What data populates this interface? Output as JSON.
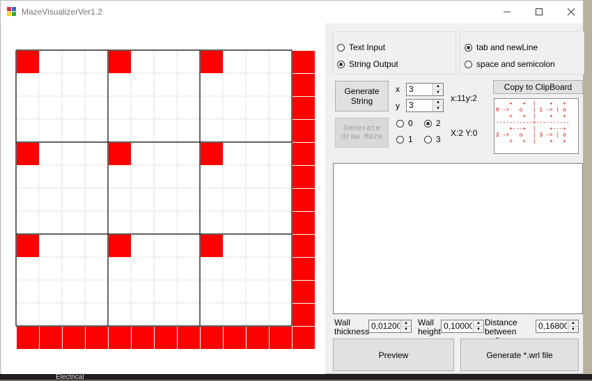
{
  "window": {
    "title": "MazeVisualizerVer1.2"
  },
  "mode": {
    "text_input": "Text Input",
    "string_output": "String Output",
    "selected": "string_output"
  },
  "format": {
    "tab_newline": "tab and newLine",
    "space_semicolon": "space and semicolon",
    "selected": "tab_newline"
  },
  "buttons": {
    "generate_string": "Generate String",
    "generate_draw_maze": "Generate draw Maze",
    "copy": "Copy to ClipBoard",
    "preview": "Preview",
    "generate_wrl": "Generate *.wrl file"
  },
  "size": {
    "x_label": "x",
    "x_value": "3",
    "y_label": "y",
    "y_value": "3",
    "info": "x:11y:2"
  },
  "cell_options": {
    "o0": "0",
    "o1": "1",
    "o2": "2",
    "o3": "3",
    "selected": "2",
    "coords": "X:2 Y:0"
  },
  "preview_text": "    +   +  |    +   +\n0 ->   o   | 1 -> | o\n    +   +  |    +   +\n-----------+----------\n    +---+  |    +---+\n2 ->   o   | 3 -> | o\n    +   +  |    +   +",
  "params": {
    "wall_thickness_label": "Wall thickness",
    "wall_thickness": "0,01200",
    "wall_height_label": "Wall height",
    "wall_height": "0,10000",
    "distance_label": "Distance between walls",
    "distance": "0,16800"
  },
  "output_text": "",
  "taskbar_text": "Electrical",
  "colors": {
    "cell_fill": "#ff0000",
    "grid": "#e6e6e6",
    "wall": "#000000"
  }
}
